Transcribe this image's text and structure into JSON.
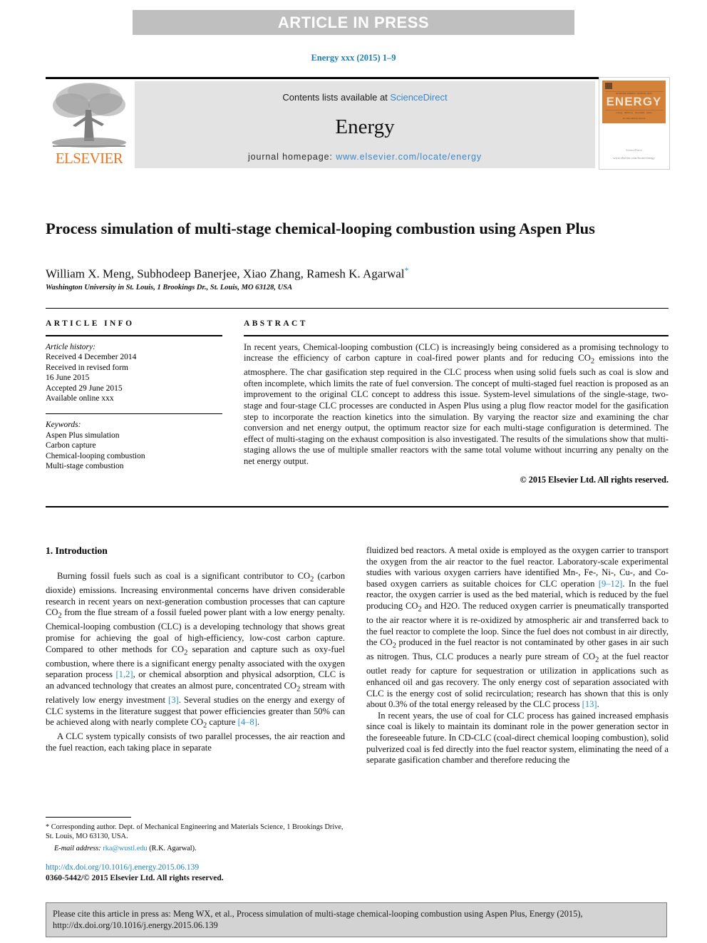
{
  "banner": {
    "label": "ARTICLE IN PRESS"
  },
  "running_head": {
    "text": "Energy xxx (2015) 1–9"
  },
  "masthead": {
    "contents_prefix": "Contents lists available at ",
    "sciencedirect": "ScienceDirect",
    "journal_name": "Energy",
    "homepage_prefix": "journal homepage: ",
    "homepage_url": "www.elsevier.com/locate/energy",
    "publisher_logo_text": "ELSEVIER",
    "cover": {
      "title": "ENERGY",
      "subtitle": "An International Journal",
      "publisher": "ScienceDirect",
      "publisher_sub": "www.elsevier.com/locate/energy"
    }
  },
  "article": {
    "title": "Process simulation of multi-stage chemical-looping combustion using Aspen Plus",
    "authors": "William X. Meng, Subhodeep Banerjee, Xiao Zhang, Ramesh K. Agarwal",
    "corresponding_marker": "*",
    "affiliation": "Washington University in St. Louis, 1 Brookings Dr., St. Louis, MO 63128, USA"
  },
  "info": {
    "heading": "ARTICLE INFO",
    "history_label": "Article history:",
    "history": [
      "Received 4 December 2014",
      "Received in revised form",
      "16 June 2015",
      "Accepted 29 June 2015",
      "Available online xxx"
    ],
    "keywords_label": "Keywords:",
    "keywords": [
      "Aspen Plus simulation",
      "Carbon capture",
      "Chemical-looping combustion",
      "Multi-stage combustion"
    ]
  },
  "abstract": {
    "heading": "ABSTRACT",
    "body": "In recent years, Chemical-looping combustion (CLC) is increasingly being considered as a promising technology to increase the efficiency of carbon capture in coal-fired power plants and for reducing CO2 emissions into the atmosphere. The char gasification step required in the CLC process when using solid fuels such as coal is slow and often incomplete, which limits the rate of fuel conversion. The concept of multi-staged fuel reaction is proposed as an improvement to the original CLC concept to address this issue. System-level simulations of the single-stage, two-stage and four-stage CLC processes are conducted in Aspen Plus using a plug flow reactor model for the gasification step to incorporate the reaction kinetics into the simulation. By varying the reactor size and examining the char conversion and net energy output, the optimum reactor size for each multi-stage configuration is determined. The effect of multi-staging on the exhaust composition is also investigated. The results of the simulations show that multi-staging allows the use of multiple smaller reactors with the same total volume without incurring any penalty on the net energy output.",
    "copyright": "© 2015 Elsevier Ltd. All rights reserved."
  },
  "body": {
    "section_heading": "1. Introduction",
    "left_paragraph_1": "Burning fossil fuels such as coal is a significant contributor to CO2 (carbon dioxide) emissions. Increasing environmental concerns have driven considerable research in recent years on next-generation combustion processes that can capture CO2 from the flue stream of a fossil fueled power plant with a low energy penalty. Chemical-looping combustion (CLC) is a developing technology that shows great promise for achieving the goal of high-efficiency, low-cost carbon capture. Compared to other methods for CO2 separation and capture such as oxy-fuel combustion, where there is a significant energy penalty associated with the oxygen separation process [1,2], or chemical absorption and physical adsorption, CLC is an advanced technology that creates an almost pure, concentrated CO2 stream with relatively low energy investment [3]. Several studies on the energy and exergy of CLC systems in the literature suggest that power efficiencies greater than 50% can be achieved along with nearly complete CO2 capture [4–8].",
    "left_paragraph_2": "A CLC system typically consists of two parallel processes, the air reaction and the fuel reaction, each taking place in separate",
    "right_paragraph_1": "fluidized bed reactors. A metal oxide is employed as the oxygen carrier to transport the oxygen from the air reactor to the fuel reactor. Laboratory-scale experimental studies with various oxygen carriers have identified Mn-, Fe-, Ni-, Cu-, and Co-based oxygen carriers as suitable choices for CLC operation [9–12]. In the fuel reactor, the oxygen carrier is used as the bed material, which is reduced by the fuel producing CO2 and H2O. The reduced oxygen carrier is pneumatically transported to the air reactor where it is re-oxidized by atmospheric air and transferred back to the fuel reactor to complete the loop. Since the fuel does not combust in air directly, the CO2 produced in the fuel reactor is not contaminated by other gases in air such as nitrogen. Thus, CLC produces a nearly pure stream of CO2 at the fuel reactor outlet ready for capture for sequestration or utilization in applications such as enhanced oil and gas recovery. The only energy cost of separation associated with CLC is the energy cost of solid recirculation; research has shown that this is only about 0.3% of the total energy released by the CLC process [13].",
    "right_paragraph_2": "In recent years, the use of coal for CLC process has gained increased emphasis since coal is likely to maintain its dominant role in the power generation sector in the foreseeable future. In CD-CLC (coal-direct chemical looping combustion), solid pulverized coal is fed directly into the fuel reactor system, eliminating the need of a separate gasification chamber and therefore reducing the"
  },
  "footnote": {
    "marker": "*",
    "text": "Corresponding author. Dept. of Mechanical Engineering and Materials Science, 1 Brookings Drive, St. Louis, MO 63130, USA.",
    "email_label": "E-mail address:",
    "email": "rka@wustl.edu",
    "email_suffix": "(R.K. Agarwal)."
  },
  "doi_footer": {
    "doi_url": "http://dx.doi.org/10.1016/j.energy.2015.06.139",
    "issn_line": "0360-5442/© 2015 Elsevier Ltd. All rights reserved."
  },
  "cite_box": {
    "text": "Please cite this article in press as: Meng WX, et al., Process simulation of multi-stage chemical-looping combustion using Aspen Plus, Energy (2015), http://dx.doi.org/10.1016/j.energy.2015.06.139"
  },
  "colors": {
    "banner_bg": "#bfbfbf",
    "link_blue": "#2a8fc4",
    "elsevier_orange": "#E87722",
    "masthead_gray": "#e3e3e3",
    "cite_bg": "#d3d3d3"
  }
}
